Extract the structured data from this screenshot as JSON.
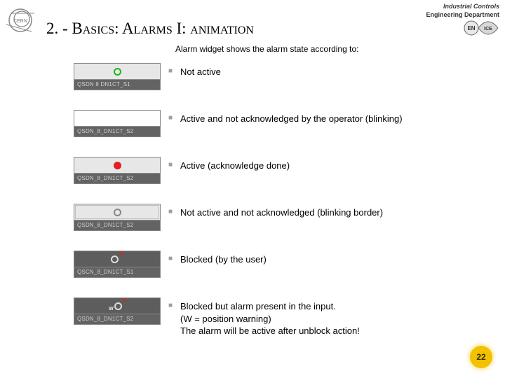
{
  "header": {
    "ic_line1": "Industrial Controls",
    "ic_line2": "Engineering Department",
    "enice_en": "EN",
    "enice_ice": "ICE"
  },
  "title": {
    "pre": "2. - B",
    "t1": "asics",
    "sep1": ": A",
    "t2": "larms",
    "mid": " I: ",
    "t3": "animation"
  },
  "subtitle": "Alarm widget shows the alarm state according to:",
  "rows": [
    {
      "label": "QSDN 8 DN1CT_S1",
      "desc": "Not active",
      "sup": ""
    },
    {
      "label": "QSDN_8_DN1CT_S2",
      "desc": "Active and not acknowledged by the operator (blinking)",
      "sup": ""
    },
    {
      "label": "QSDN_8_DN1CT_S2",
      "desc": "Active (acknowledge done)",
      "sup": ""
    },
    {
      "label": "QSDN_8_DN1CT_S2",
      "desc": "Not active and not acknowledged (blinking border)",
      "sup": ""
    },
    {
      "label": "QSCN_8_DN1CT_S1",
      "desc": "Blocked (by the user)",
      "sup": "B"
    },
    {
      "label": "QSDN_8_DN1CT_S2",
      "desc": "Blocked but alarm present in the input.\n(W = position warning)\nThe alarm will be active after unblock action!",
      "sup": "W",
      "sup2": "B"
    }
  ],
  "pagenum": "22"
}
